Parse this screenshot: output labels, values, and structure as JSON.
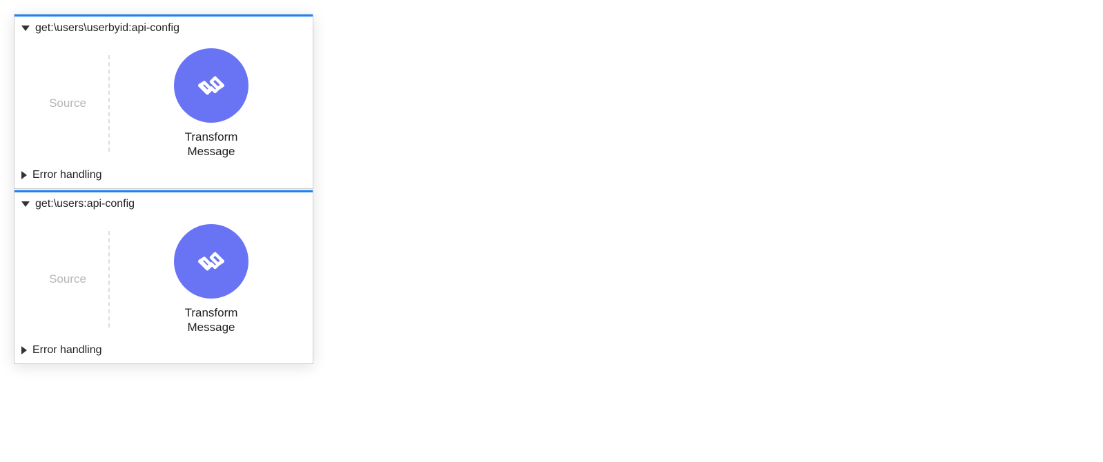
{
  "flows": [
    {
      "title": "get:\\users\\userbyid:api-config",
      "source_label": "Source",
      "node_label_line1": "Transform",
      "node_label_line2": "Message",
      "error_label": "Error handling"
    },
    {
      "title": "get:\\users:api-config",
      "source_label": "Source",
      "node_label_line1": "Transform",
      "node_label_line2": "Message",
      "error_label": "Error handling"
    }
  ],
  "colors": {
    "accent": "#1a84ff",
    "node": "#6974f4"
  }
}
